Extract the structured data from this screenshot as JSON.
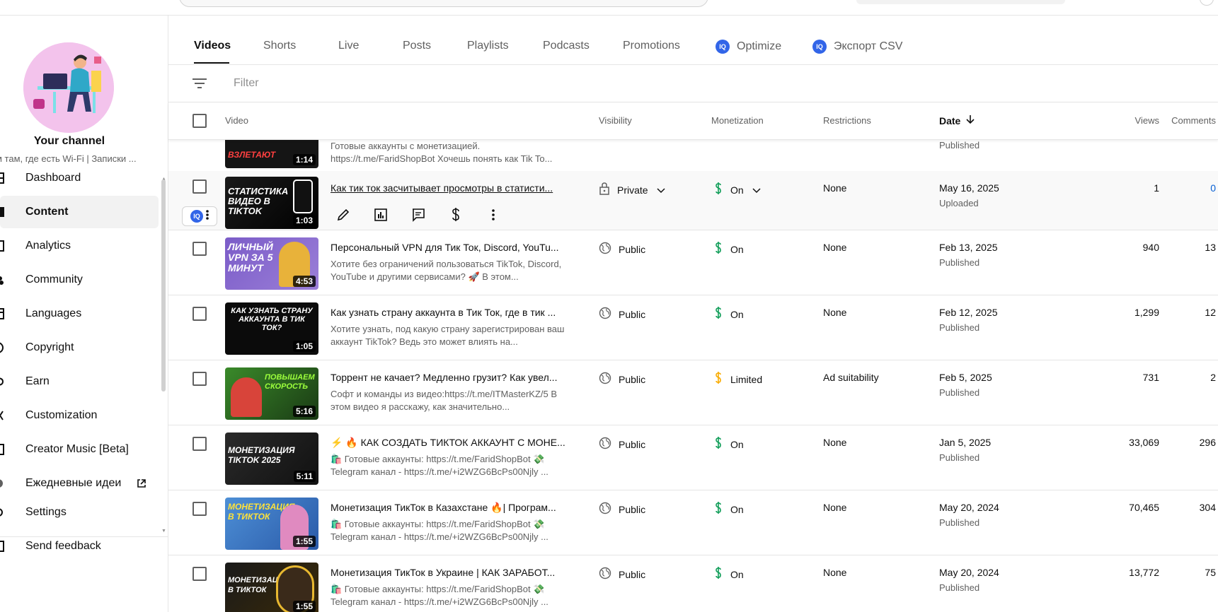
{
  "tabs": [
    {
      "label": "Videos"
    },
    {
      "label": "Shorts"
    },
    {
      "label": "Live"
    },
    {
      "label": "Posts"
    },
    {
      "label": "Playlists"
    },
    {
      "label": "Podcasts"
    },
    {
      "label": "Promotions"
    },
    {
      "label": "Optimize"
    },
    {
      "label": "Экспорт CSV"
    }
  ],
  "filter": {
    "placeholder": "Filter"
  },
  "sidebar": {
    "channel_title": "Your channel",
    "channel_subtitle": "м там, где есть Wi-Fi | Записки ...",
    "items": [
      {
        "label": "Dashboard",
        "icon": "dashboard-icon"
      },
      {
        "label": "Content",
        "icon": "content-icon"
      },
      {
        "label": "Analytics",
        "icon": "analytics-icon"
      },
      {
        "label": "Community",
        "icon": "community-icon"
      },
      {
        "label": "Languages",
        "icon": "languages-icon"
      },
      {
        "label": "Copyright",
        "icon": "copyright-icon"
      },
      {
        "label": "Earn",
        "icon": "earn-icon"
      },
      {
        "label": "Customization",
        "icon": "customization-icon"
      },
      {
        "label": "Creator Music [Beta]",
        "icon": "creator-music-icon"
      },
      {
        "label": "Ежедневные идеи",
        "icon": "ideas-icon"
      },
      {
        "label": "Settings",
        "icon": "settings-icon"
      },
      {
        "label": "Send feedback",
        "icon": "feedback-icon"
      }
    ]
  },
  "table": {
    "headers": {
      "video": "Video",
      "visibility": "Visibility",
      "monetization": "Monetization",
      "restrictions": "Restrictions",
      "date": "Date",
      "views": "Views",
      "comments": "Comments"
    },
    "partial_row": {
      "thumb_text": "ВЗЛЕТАЮТ",
      "duration": "1:14",
      "desc_line1": "Готовые аккаунты с монетизацией.",
      "desc_line2": "https://t.me/FaridShopBot Хочешь понять как Tik To...",
      "date_status": "Published"
    },
    "rows": [
      {
        "thumb_text": "СТАТИСТИКА ВИДЕО В TIKTOK",
        "duration": "1:03",
        "title": "Как тик ток засчитывает просмотры в статисти...",
        "description": "",
        "visibility": "Private",
        "monetization": "On",
        "restrictions": "None",
        "date": "May 16, 2025",
        "date_status": "Uploaded",
        "views": "1",
        "comments": "0"
      },
      {
        "thumb_text": "ЛИЧНЫЙ VPN ЗА 5 МИНУТ",
        "duration": "4:53",
        "title": "Персональный VPN для Тик Ток, Discord, YouTu...",
        "description": "Хотите без ограничений пользоваться TikTok, Discord, YouTube и другими сервисами? 🚀 В этом...",
        "visibility": "Public",
        "monetization": "On",
        "restrictions": "None",
        "date": "Feb 13, 2025",
        "date_status": "Published",
        "views": "940",
        "comments": "13"
      },
      {
        "thumb_text": "КАК УЗНАТЬ СТРАНУ АККАУНТА В ТИК ТОК?",
        "duration": "1:05",
        "title": "Как узнать страну аккаунта в Тик Ток, где в тик ...",
        "description": "Хотите узнать, под какую страну зарегистрирован ваш аккаунт TikTok? Ведь это может влиять на...",
        "visibility": "Public",
        "monetization": "On",
        "restrictions": "None",
        "date": "Feb 12, 2025",
        "date_status": "Published",
        "views": "1,299",
        "comments": "12"
      },
      {
        "thumb_text": "ПОВЫШАЕМ СКОРОСТЬ",
        "duration": "5:16",
        "title": "Торрент не качает? Медленно грузит? Как увел...",
        "description": "Софт и команды из видео:https://t.me/ITMasterKZ/5 В этом видео я расскажу, как значительно...",
        "visibility": "Public",
        "monetization": "Limited",
        "restrictions": "Ad suitability",
        "date": "Feb 5, 2025",
        "date_status": "Published",
        "views": "731",
        "comments": "2"
      },
      {
        "thumb_text": "МОНЕТИЗАЦИЯ TIKTOK 2025",
        "duration": "5:11",
        "title": "⚡ 🔥 КАК СОЗДАТЬ ТИКТОК АККАУНТ С МОНЕ...",
        "description": "🛍️ Готовые аккаунты: https://t.me/FaridShopBot 💸 Telegram канал - https://t.me/+i2WZG6BcPs00Njly ...",
        "visibility": "Public",
        "monetization": "On",
        "restrictions": "None",
        "date": "Jan 5, 2025",
        "date_status": "Published",
        "views": "33,069",
        "comments": "296"
      },
      {
        "thumb_text": "МОНЕТИЗАЦИЯ В ТИКТОК",
        "duration": "1:55",
        "title": "Монетизация ТикТок в Казахстане 🔥| Програм...",
        "description": "🛍️ Готовые аккаунты: https://t.me/FaridShopBot 💸 Telegram канал - https://t.me/+i2WZG6BcPs00Njly ...",
        "visibility": "Public",
        "monetization": "On",
        "restrictions": "None",
        "date": "May 20, 2024",
        "date_status": "Published",
        "views": "70,465",
        "comments": "304"
      },
      {
        "thumb_text": "МОНЕТИЗАЦИЯ В ТИКТОК",
        "duration": "1:55",
        "title": "Монетизация ТикТок в Украине | КАК ЗАРАБОТ...",
        "description": "🛍️ Готовые аккаунты: https://t.me/FaridShopBot 💸 Telegram канал - https://t.me/+i2WZG6BcPs00Njly ...",
        "visibility": "Public",
        "monetization": "On",
        "restrictions": "None",
        "date": "May 20, 2024",
        "date_status": "Published",
        "views": "13,772",
        "comments": "75"
      }
    ]
  },
  "colors": {
    "monetization_on": "#0f9d58",
    "monetization_limited": "#f9ab00",
    "link_blue": "#065fd4",
    "extension_badge": "#3265e8"
  }
}
